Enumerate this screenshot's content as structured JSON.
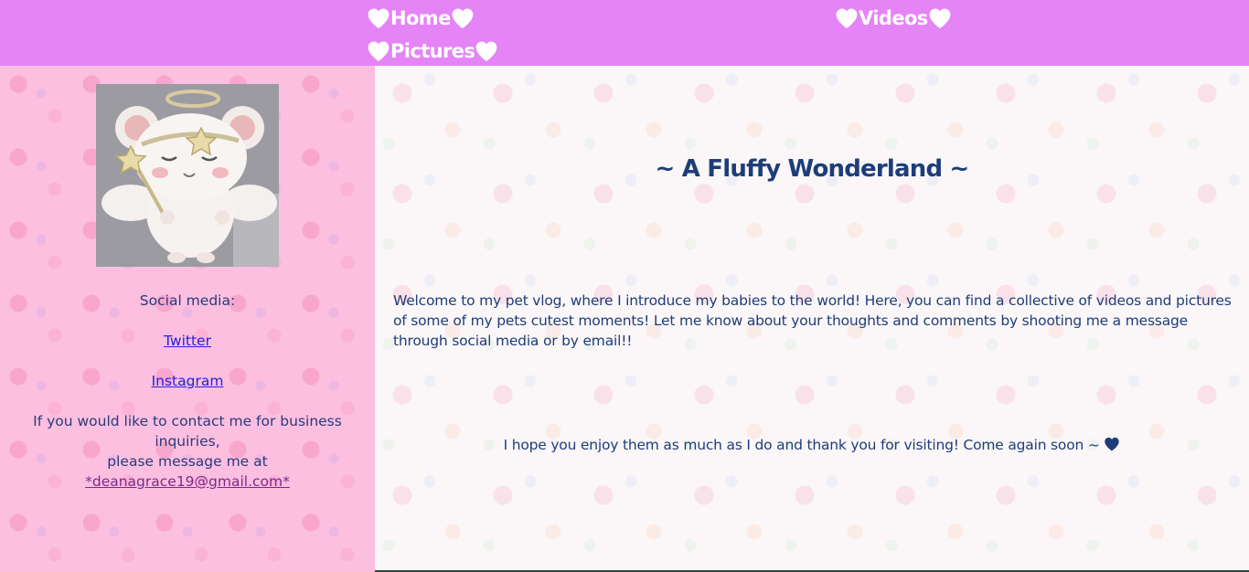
{
  "nav": {
    "home_label": "Home",
    "videos_label": "Videos",
    "pictures_label": "Pictures",
    "background_color": "#e584f7",
    "heart_icon": "heart-icon"
  },
  "sidebar": {
    "avatar_alt": "angel hamster",
    "social_heading": "Social media:",
    "twitter_label": "Twitter",
    "instagram_label": "Instagram",
    "contact_line1": "If you would like to contact me for business inquiries,",
    "contact_line2": "please message me at",
    "email_label": "*deanagrace19@gmail.com*",
    "background_color": "#fcbfe0"
  },
  "main": {
    "title": "~ A Fluffy Wonderland ~",
    "intro": "Welcome to my pet vlog, where I introduce my babies to the world! Here, you can find a collective of videos and pictures of some of my pets cutest moments! Let me know about your thoughts and comments by shooting me a message through social media or by email!!",
    "closing": "I hope you enjoy them as much as I do and thank you for visiting! Come again soon ~",
    "text_color": "#1e3d78"
  }
}
